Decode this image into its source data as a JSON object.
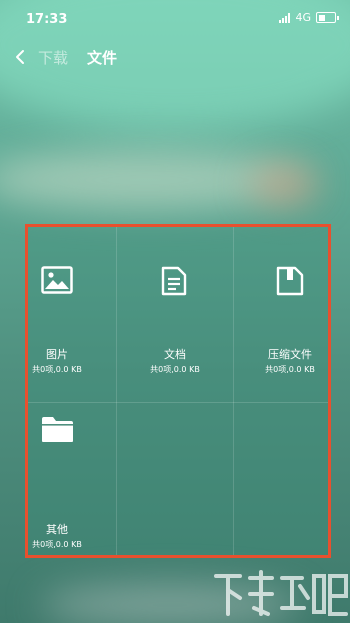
{
  "status_bar": {
    "time": "17:33",
    "network": "4G"
  },
  "nav": {
    "previous": "下载",
    "current": "文件"
  },
  "categories": [
    {
      "label": "图片",
      "count": "共0项,0.0 KB",
      "icon": "image-icon"
    },
    {
      "label": "文档",
      "count": "共0项,0.0 KB",
      "icon": "document-icon"
    },
    {
      "label": "压缩文件",
      "count": "共0项,0.0 KB",
      "icon": "archive-icon"
    },
    {
      "label": "其他",
      "count": "共0项,0.0 KB",
      "icon": "folder-icon"
    }
  ],
  "colors": {
    "highlight": "#e8502e",
    "background": "#5fa995"
  }
}
